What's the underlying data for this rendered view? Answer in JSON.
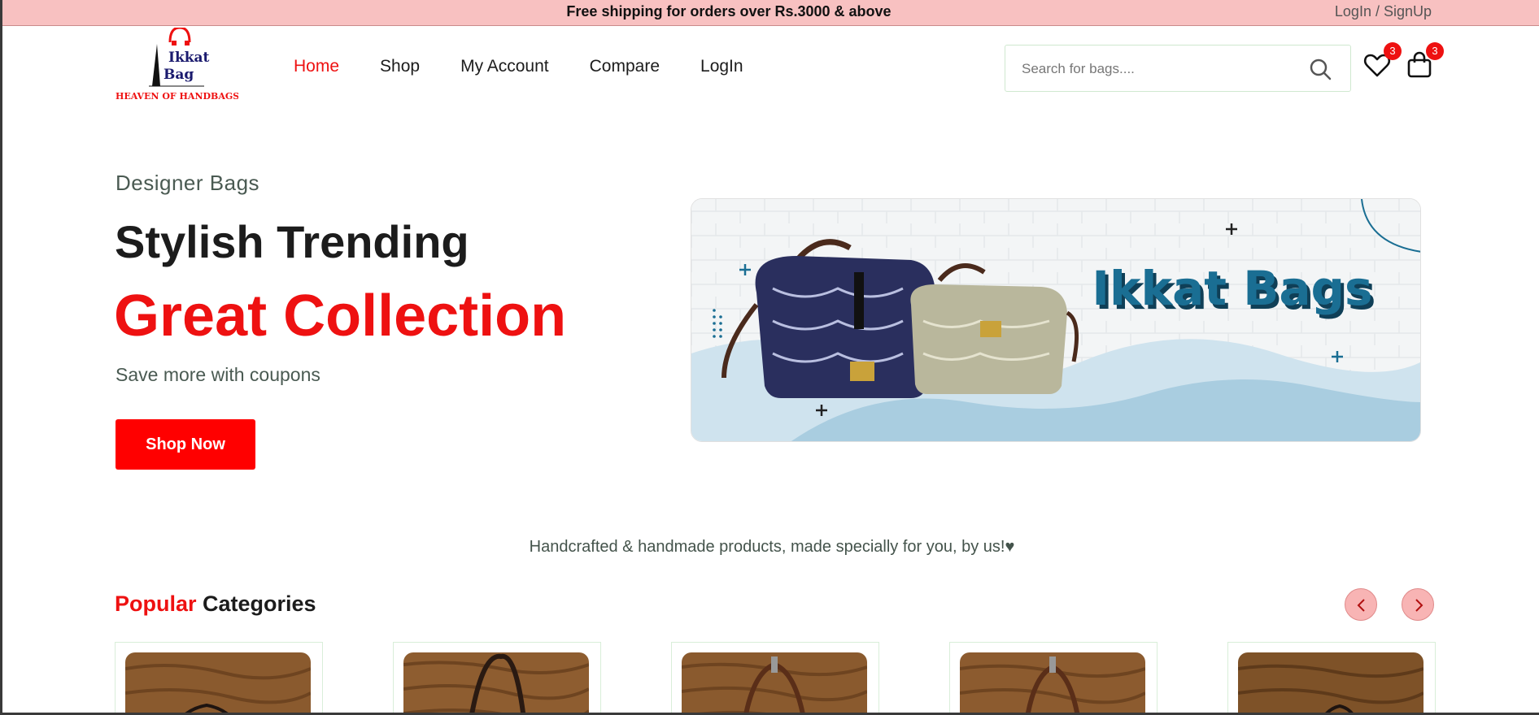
{
  "topbar": {
    "promo": "Free shipping for orders over Rs.3000 & above",
    "auth_link": "LogIn / SignUp"
  },
  "logo": {
    "line1": "Ikkat",
    "line2": "Bag",
    "tagline": "HEAVEN OF HANDBAGS"
  },
  "nav": {
    "items": [
      {
        "label": "Home",
        "active": true
      },
      {
        "label": "Shop"
      },
      {
        "label": "My Account"
      },
      {
        "label": "Compare"
      },
      {
        "label": "LogIn"
      }
    ]
  },
  "search": {
    "placeholder": "Search for bags....",
    "icon": "search-icon"
  },
  "header_icons": {
    "wishlist": {
      "icon": "heart-icon",
      "count": "3"
    },
    "cart": {
      "icon": "shopping-bag-icon",
      "count": "3"
    }
  },
  "hero": {
    "subtitle": "Designer Bags",
    "title": "Stylish Trending",
    "highlight": "Great Collection",
    "description": "Save more with coupons",
    "cta": "Shop Now",
    "banner_text": "Ikkat Bags"
  },
  "tagline": "Handcrafted & handmade products, made specially for you, by us!♥",
  "popular": {
    "title_highlight": "Popular",
    "title_rest": " Categories",
    "prev_icon": "chevron-left-icon",
    "next_icon": "chevron-right-icon",
    "cards": [
      {},
      {},
      {},
      {},
      {}
    ]
  },
  "colors": {
    "accent": "#ee1111",
    "topbar_bg": "#f8c1c1",
    "banner_title": "#1a6e93",
    "text_muted": "#4a5a52"
  }
}
